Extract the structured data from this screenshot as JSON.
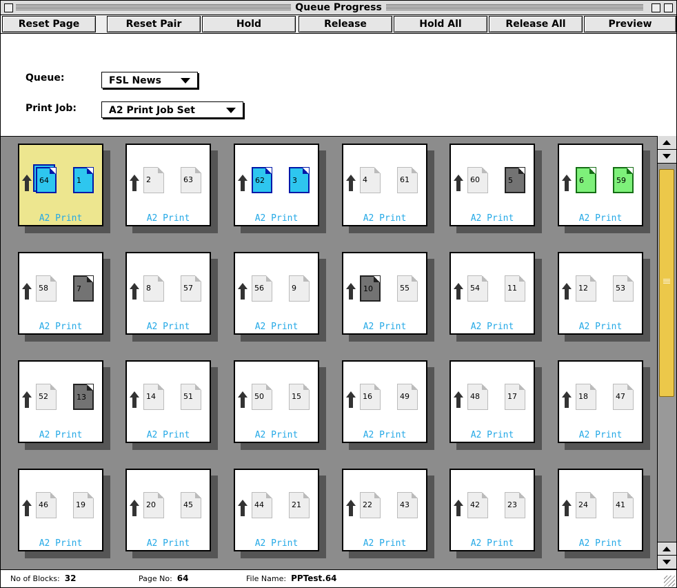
{
  "window": {
    "title": "Queue Progress"
  },
  "toolbar": {
    "buttons": [
      "Reset Page",
      "Reset Pair",
      "Hold",
      "Release",
      "Hold All",
      "Release All",
      "Preview"
    ]
  },
  "form": {
    "queue_label": "Queue:",
    "queue_value": "FSL News",
    "print_job_label": "Print Job:",
    "print_job_value": "A2 Print Job Set"
  },
  "colors": {
    "selected_card": "#ede68f",
    "blue_page": "#2ec6ef",
    "green_page": "#7ef07a",
    "dark_page": "#737373",
    "card_label": "#23a8e6",
    "scroll_thumb": "#ecc84a"
  },
  "cards": [
    {
      "left": "64",
      "right": "1",
      "lstate": "blue",
      "rstate": "blue",
      "label": "A2 Print",
      "selected": true,
      "stacked": true
    },
    {
      "left": "2",
      "right": "63",
      "lstate": "normal",
      "rstate": "normal",
      "label": "A2 Print"
    },
    {
      "left": "62",
      "right": "3",
      "lstate": "blue",
      "rstate": "blue",
      "label": "A2 Print"
    },
    {
      "left": "4",
      "right": "61",
      "lstate": "normal",
      "rstate": "normal",
      "label": "A2 Print"
    },
    {
      "left": "60",
      "right": "5",
      "lstate": "normal",
      "rstate": "dark",
      "label": "A2 Print"
    },
    {
      "left": "6",
      "right": "59",
      "lstate": "green",
      "rstate": "green",
      "label": "A2 Print"
    },
    {
      "left": "58",
      "right": "7",
      "lstate": "normal",
      "rstate": "dark",
      "label": "A2 Print"
    },
    {
      "left": "8",
      "right": "57",
      "lstate": "normal",
      "rstate": "normal",
      "label": "A2 Print"
    },
    {
      "left": "56",
      "right": "9",
      "lstate": "normal",
      "rstate": "normal",
      "label": "A2 Print"
    },
    {
      "left": "10",
      "right": "55",
      "lstate": "dark",
      "rstate": "normal",
      "label": "A2 Print"
    },
    {
      "left": "54",
      "right": "11",
      "lstate": "normal",
      "rstate": "normal",
      "label": "A2 Print"
    },
    {
      "left": "12",
      "right": "53",
      "lstate": "normal",
      "rstate": "normal",
      "label": "A2 Print"
    },
    {
      "left": "52",
      "right": "13",
      "lstate": "normal",
      "rstate": "dark",
      "label": "A2 Print"
    },
    {
      "left": "14",
      "right": "51",
      "lstate": "normal",
      "rstate": "normal",
      "label": "A2 Print"
    },
    {
      "left": "50",
      "right": "15",
      "lstate": "normal",
      "rstate": "normal",
      "label": "A2 Print"
    },
    {
      "left": "16",
      "right": "49",
      "lstate": "normal",
      "rstate": "normal",
      "label": "A2 Print"
    },
    {
      "left": "48",
      "right": "17",
      "lstate": "normal",
      "rstate": "normal",
      "label": "A2 Print"
    },
    {
      "left": "18",
      "right": "47",
      "lstate": "normal",
      "rstate": "normal",
      "label": "A2 Print"
    },
    {
      "left": "46",
      "right": "19",
      "lstate": "normal",
      "rstate": "normal",
      "label": "A2 Print"
    },
    {
      "left": "20",
      "right": "45",
      "lstate": "normal",
      "rstate": "normal",
      "label": "A2 Print"
    },
    {
      "left": "44",
      "right": "21",
      "lstate": "normal",
      "rstate": "normal",
      "label": "A2 Print"
    },
    {
      "left": "22",
      "right": "43",
      "lstate": "normal",
      "rstate": "normal",
      "label": "A2 Print"
    },
    {
      "left": "42",
      "right": "23",
      "lstate": "normal",
      "rstate": "normal",
      "label": "A2 Print"
    },
    {
      "left": "24",
      "right": "41",
      "lstate": "normal",
      "rstate": "normal",
      "label": "A2 Print"
    }
  ],
  "status": {
    "blocks_label": "No of Blocks:",
    "blocks_value": "32",
    "page_label": "Page No:",
    "page_value": "64",
    "file_label": "File Name:",
    "file_value": "PPTest.64"
  }
}
